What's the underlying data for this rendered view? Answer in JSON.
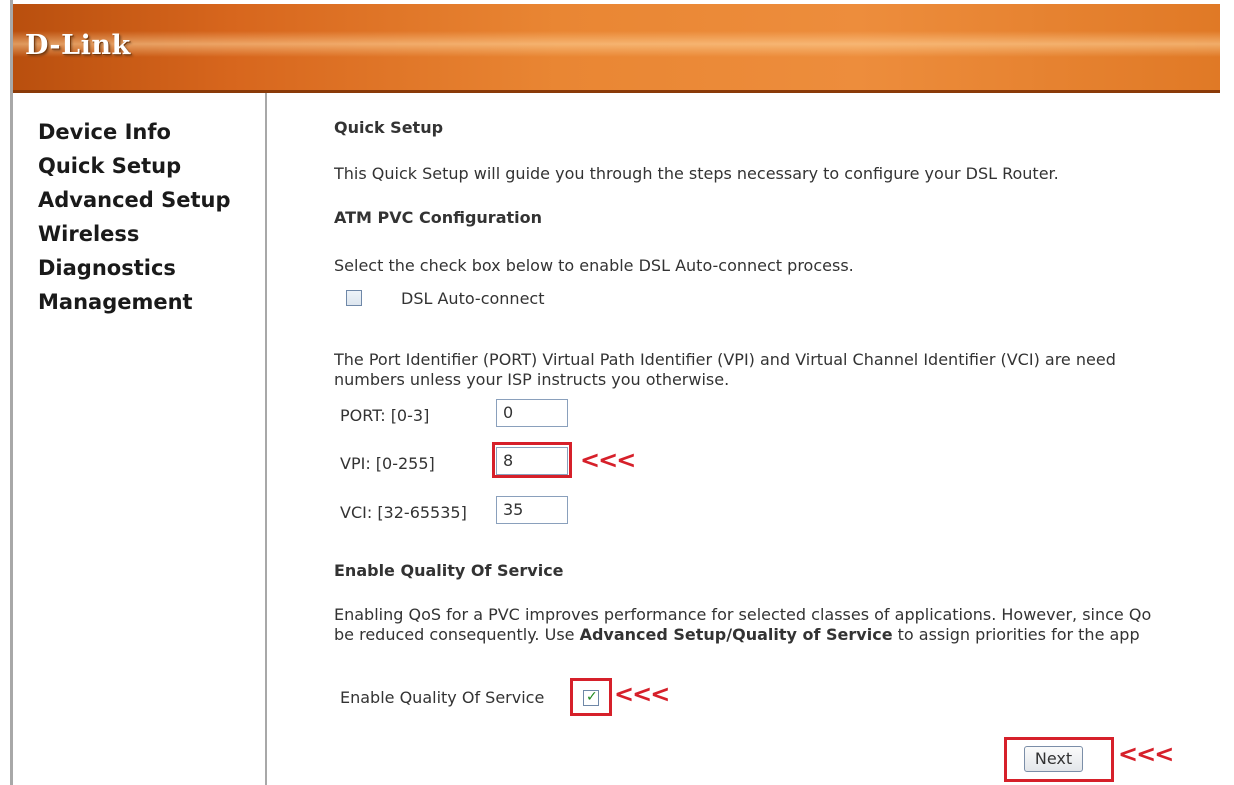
{
  "header": {
    "logo": "D-Link"
  },
  "sidebar": {
    "items": [
      {
        "label": "Device Info"
      },
      {
        "label": "Quick Setup"
      },
      {
        "label": "Advanced Setup"
      },
      {
        "label": "Wireless"
      },
      {
        "label": "Diagnostics"
      },
      {
        "label": "Management"
      }
    ]
  },
  "main": {
    "title": "Quick Setup",
    "intro": "This Quick Setup will guide you through the steps necessary to configure your DSL Router.",
    "atm_heading": "ATM PVC Configuration",
    "auto_connect_prompt": "Select the check box below to enable DSL Auto-connect process.",
    "auto_connect_label": "DSL Auto-connect",
    "auto_connect_checked": false,
    "identifier_text_1": "The Port Identifier (PORT) Virtual Path Identifier (VPI) and Virtual Channel Identifier (VCI) are need",
    "identifier_text_2": "numbers unless your ISP instructs you otherwise.",
    "port_label": "PORT: [0-3]",
    "port_value": "0",
    "vpi_label": "VPI: [0-255]",
    "vpi_value": "8",
    "vci_label": "VCI: [32-65535]",
    "vci_value": "35",
    "qos_heading": "Enable Quality Of Service",
    "qos_text_1": "Enabling QoS for a PVC improves performance for selected classes of applications. However, since Qo",
    "qos_text_2_pre": "be reduced consequently. Use ",
    "qos_text_2_bold": "Advanced Setup/Quality of Service",
    "qos_text_2_post": " to assign priorities for the app",
    "qos_label": "Enable Quality Of Service",
    "qos_checked": true,
    "next_label": "Next"
  },
  "annotations": {
    "arrow": "<<<",
    "color": "#d6202a"
  },
  "colors": {
    "header_orange": "#e98633",
    "highlight_red": "#d6202a"
  }
}
